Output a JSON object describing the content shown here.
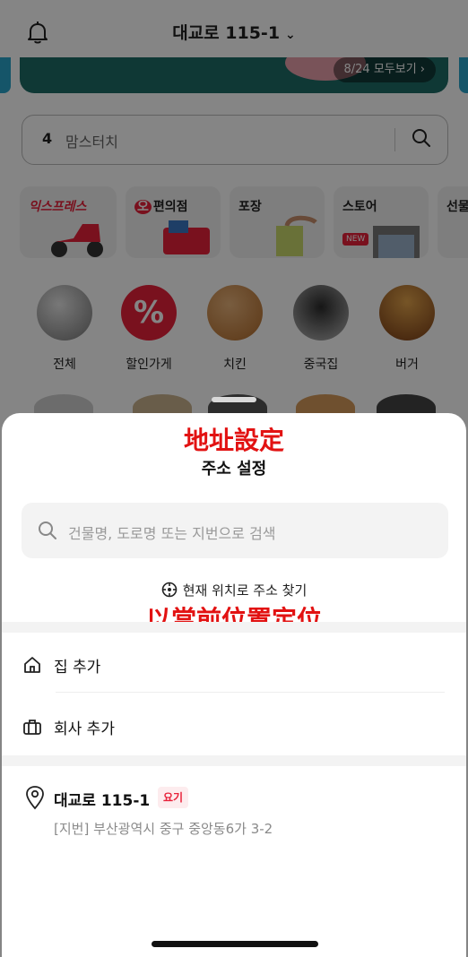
{
  "background": {
    "location_title": "대교로 115-1",
    "banner_pager": "8/24 모두보기 ›",
    "search": {
      "count": "4",
      "text": "맘스터치"
    },
    "categories": [
      "익스프레스",
      "편의점",
      "포장",
      "스토어",
      "선물"
    ],
    "cat_badge_o": "오",
    "cat_new": "NEW",
    "foods": [
      "전체",
      "할인가게",
      "치킨",
      "중국집",
      "버거"
    ]
  },
  "sheet": {
    "annotation_top": "地址設定",
    "title": "주소 설정",
    "search_placeholder": "건물명, 도로명 또는 지번으로 검색",
    "current_location": "현재 위치로 주소 찾기",
    "annotation_bottom": "以當前位置定位",
    "add_home": "집 추가",
    "add_work": "회사 추가",
    "recent": {
      "title": "대교로 115-1",
      "badge": "요기",
      "subtitle": "[지번] 부산광역시 중구 중앙동6가 3-2"
    }
  },
  "colors": {
    "accent_red": "#e21212",
    "badge_red": "#e8213a"
  }
}
